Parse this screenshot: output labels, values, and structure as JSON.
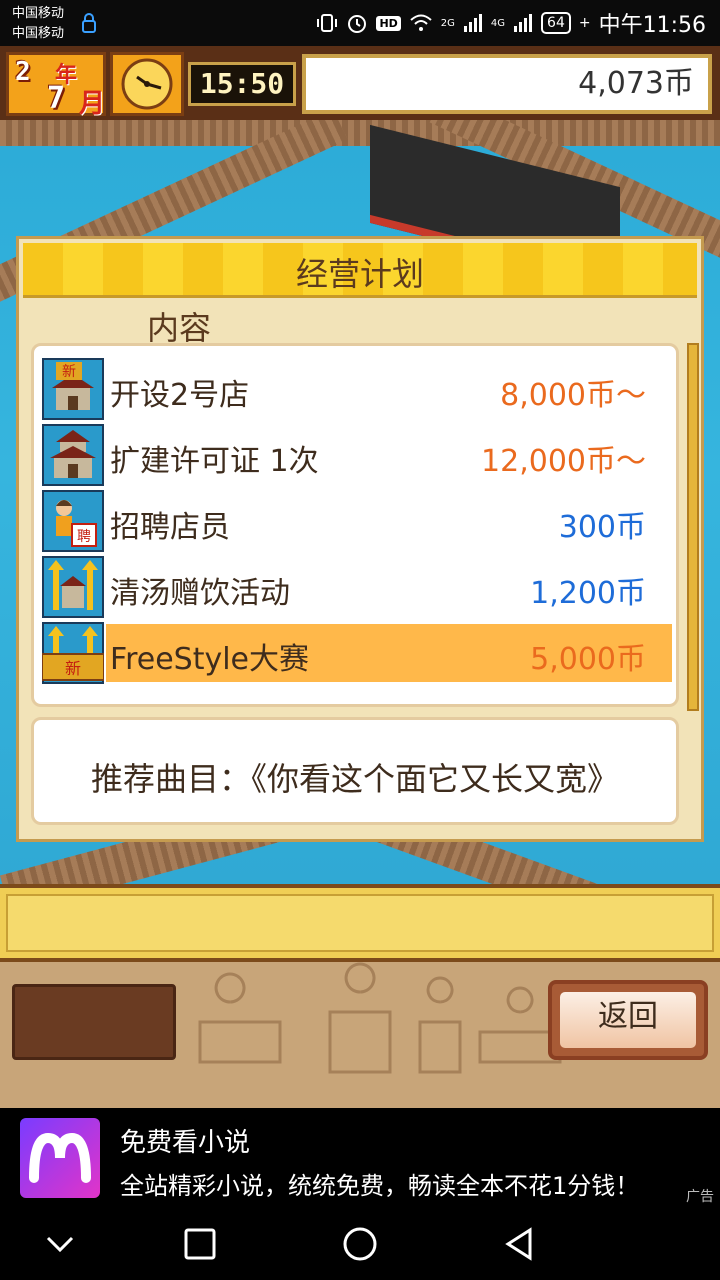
{
  "status_bar": {
    "carrier1": "中国移动",
    "carrier2": "中国移动",
    "network_2g": "2G",
    "network_4g": "4G",
    "hd_label": "HD",
    "battery": "64",
    "time": "中午11:56"
  },
  "hud": {
    "month_num": "2",
    "month_char": "年",
    "day_num": "7",
    "day_char": "月",
    "game_time": "15:50",
    "coins": "4,073币"
  },
  "dialog": {
    "title": "经营计划",
    "column_header": "内容",
    "items": [
      {
        "name": "开设2号店",
        "price": "8,000币～",
        "price_color": "orange",
        "badge": "新",
        "icon": "shop-new-icon"
      },
      {
        "name": "扩建许可证 1次",
        "price": "12,000币～",
        "price_color": "orange",
        "icon": "shop-expand-icon"
      },
      {
        "name": "招聘店员",
        "price": "300币",
        "price_color": "blue",
        "badge": "聘",
        "icon": "recruit-staff-icon"
      },
      {
        "name": "清汤赠饮活动",
        "price": "1,200币",
        "price_color": "blue",
        "icon": "campaign-arrow-icon"
      },
      {
        "name": "FreeStyle大赛",
        "price": "5,000币",
        "price_color": "orange",
        "badge": "新",
        "icon": "contest-arrow-icon",
        "selected": true
      }
    ],
    "song": "推荐曲目：《你看这个面它又长又宽》"
  },
  "bottom": {
    "back_label": "返回"
  },
  "ad": {
    "title": "免费看小说",
    "description": "全站精彩小说，统统免费，畅读全本不花1分钱！",
    "label": "广告"
  },
  "colors": {
    "price_orange": "#ea6a1e",
    "price_blue": "#1e6cd8",
    "header_gold": "#fbd224",
    "selected_row": "#ffb84a",
    "water": "#2aa9d6"
  },
  "nav": {
    "icons": [
      "chevron-down-icon",
      "square-recent-icon",
      "circle-home-icon",
      "triangle-back-icon"
    ]
  }
}
